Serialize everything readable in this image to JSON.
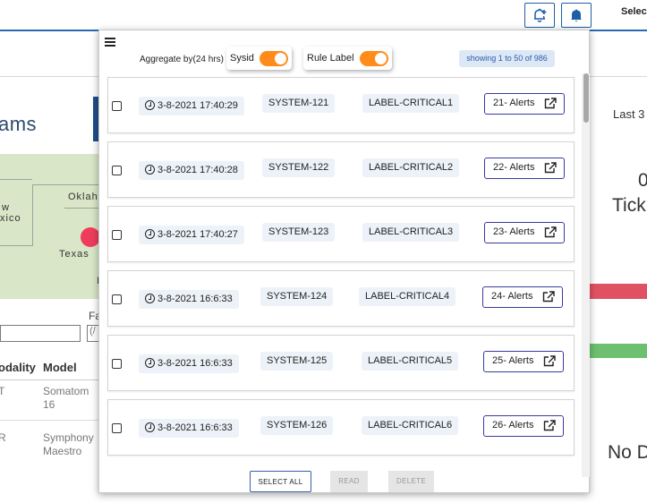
{
  "topbar": {
    "select_label": "Selec",
    "add_alert_icon": "bell-plus-icon",
    "notification_icon": "bell-icon"
  },
  "background": {
    "title": "ams",
    "map_labels": [
      "Oklah",
      "w",
      "xico",
      "Texas",
      "I"
    ],
    "filter_label": "Fa",
    "filter_value": "(/",
    "table": {
      "headers": [
        "odality",
        "Model"
      ],
      "rows": [
        {
          "modality": "T",
          "model": "Somatom 16"
        },
        {
          "modality": "R",
          "model": "Symphony Maestro"
        }
      ]
    },
    "last_label": "Last 3",
    "ticket_count": "0",
    "ticket_label": "Tick",
    "no_data_label": "No D",
    "colors": {
      "red_bar": "#e05263",
      "green_bar": "#6cc070",
      "accent": "#2a6ab0"
    }
  },
  "panel": {
    "menu_icon": "hamburger-icon",
    "aggregate_label": "Aggregate by(24 hrs)",
    "toggles": [
      {
        "label": "Sysid",
        "on": true
      },
      {
        "label": "Rule Label",
        "on": true
      }
    ],
    "toggle_color": "#ff8c1a",
    "showing_text": "showing 1 to 50 of 986",
    "rows": [
      {
        "time": "3-8-2021 17:40:29",
        "system": "SYSTEM-121",
        "label": "LABEL-CRITICAL1",
        "alerts": "21- Alerts"
      },
      {
        "time": "3-8-2021 17:40:28",
        "system": "SYSTEM-122",
        "label": "LABEL-CRITICAL2",
        "alerts": "22- Alerts"
      },
      {
        "time": "3-8-2021 17:40:27",
        "system": "SYSTEM-123",
        "label": "LABEL-CRITICAL3",
        "alerts": "23- Alerts"
      },
      {
        "time": "3-8-2021 16:6:33",
        "system": "SYSTEM-124",
        "label": "LABEL-CRITICAL4",
        "alerts": "24- Alerts"
      },
      {
        "time": "3-8-2021 16:6:33",
        "system": "SYSTEM-125",
        "label": "LABEL-CRITICAL5",
        "alerts": "25- Alerts"
      },
      {
        "time": "3-8-2021 16:6:33",
        "system": "SYSTEM-126",
        "label": "LABEL-CRITICAL6",
        "alerts": "26- Alerts"
      }
    ],
    "footer": {
      "select_all": "SELECT ALL",
      "read": "READ",
      "delete": "DELETE"
    }
  }
}
